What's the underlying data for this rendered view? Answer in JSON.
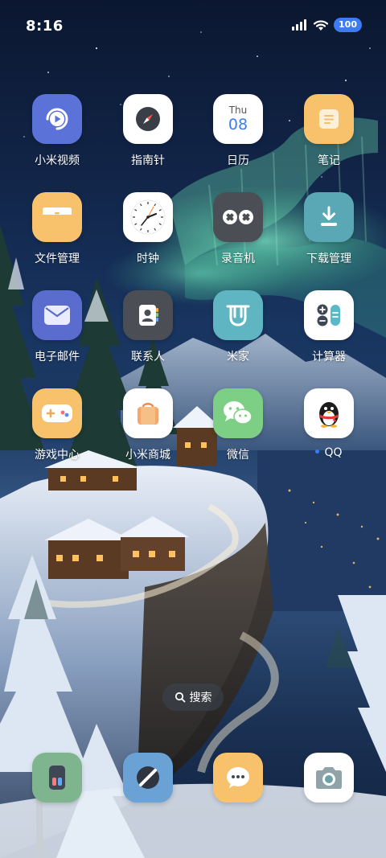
{
  "status_bar": {
    "time": "8:16",
    "battery": "100"
  },
  "apps": [
    {
      "label": "小米视频",
      "icon": "video-icon"
    },
    {
      "label": "指南针",
      "icon": "compass-icon"
    },
    {
      "label": "日历",
      "icon": "calendar-icon",
      "day": "Thu",
      "date": "08"
    },
    {
      "label": "笔记",
      "icon": "notes-icon"
    },
    {
      "label": "文件管理",
      "icon": "folder-icon"
    },
    {
      "label": "时钟",
      "icon": "clock-icon"
    },
    {
      "label": "录音机",
      "icon": "recorder-icon"
    },
    {
      "label": "下载管理",
      "icon": "download-icon"
    },
    {
      "label": "电子邮件",
      "icon": "mail-icon"
    },
    {
      "label": "联系人",
      "icon": "contacts-icon"
    },
    {
      "label": "米家",
      "icon": "mijia-icon"
    },
    {
      "label": "计算器",
      "icon": "calculator-icon"
    },
    {
      "label": "游戏中心",
      "icon": "gamepad-icon"
    },
    {
      "label": "小米商城",
      "icon": "shopping-bag-icon"
    },
    {
      "label": "微信",
      "icon": "wechat-icon"
    },
    {
      "label": "QQ",
      "icon": "qq-penguin-icon",
      "has_dot": true
    }
  ],
  "search": {
    "label": "搜索"
  },
  "dock": [
    {
      "icon": "phone-icon"
    },
    {
      "icon": "browser-icon"
    },
    {
      "icon": "messages-icon"
    },
    {
      "icon": "camera-icon"
    }
  ],
  "colors": {
    "battery_badge": "#3b7cf5",
    "wallpaper_sky": "#12264a",
    "aurora": "#5fe3b0"
  }
}
